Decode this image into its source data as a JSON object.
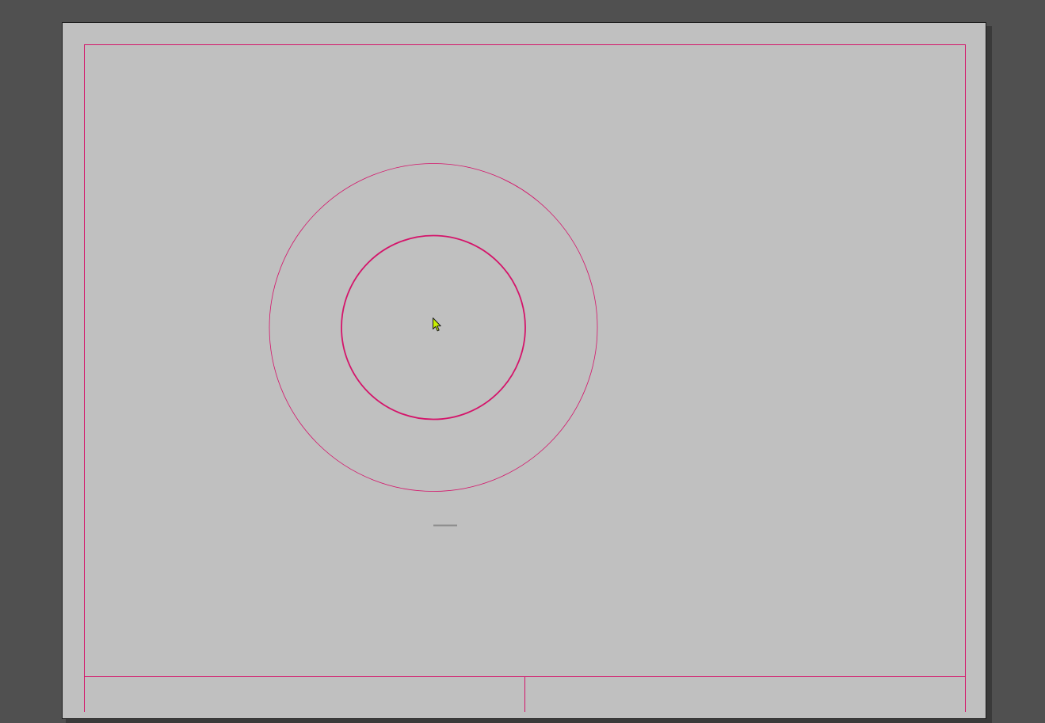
{
  "app": {
    "description_free": true
  },
  "colors": {
    "workspace": "#505050",
    "paper": "#c0c0c0",
    "guide": "#d4146a",
    "cursor": "#c8f000"
  },
  "icons": {
    "cursor": "arrow-cursor-icon"
  }
}
